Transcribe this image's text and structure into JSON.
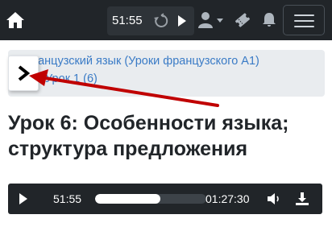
{
  "navbar": {
    "player": {
      "time": "51:55"
    },
    "icons": {
      "home": "home-icon",
      "replay": "rotate-icon",
      "play": "play-icon",
      "user": "user-icon",
      "ticket": "ticket-icon",
      "bell": "bell-icon",
      "menu": "hamburger-icon"
    }
  },
  "breadcrumb": {
    "items": [
      {
        "label": "Французский язык (Уроки французского A1)"
      },
      {
        "label": "Урок 1 (6)"
      }
    ]
  },
  "sidebar_toggle": {
    "icon": "chevron-right-icon"
  },
  "annotation": {
    "color": "#c00000"
  },
  "lesson": {
    "title": "Урок 6: Особенности языка; структура предложения"
  },
  "audio": {
    "current_time": "51:55",
    "duration": "01:27:30",
    "progress": 0.59
  },
  "colors": {
    "navbar": "#212529",
    "link": "#3a7bc6",
    "breadcrumb_bg": "#e9ecef"
  }
}
